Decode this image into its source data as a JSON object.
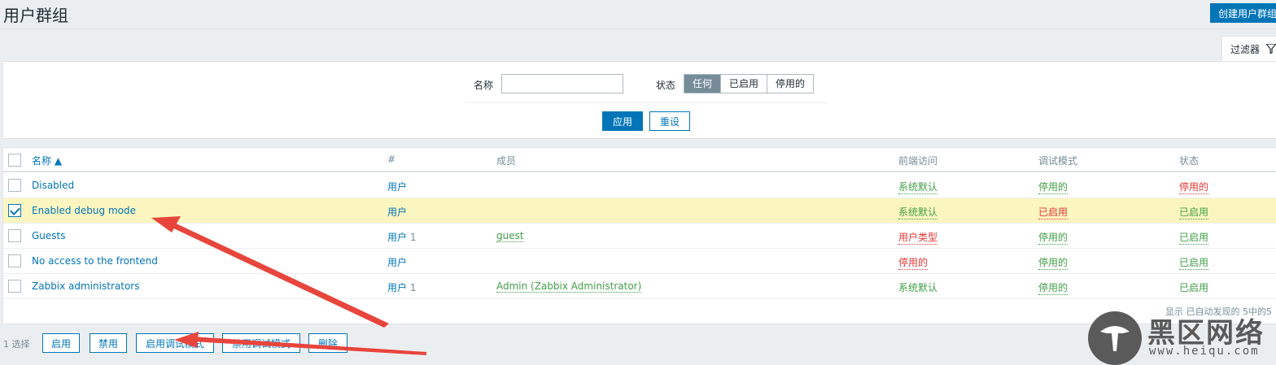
{
  "header": {
    "title": "用户群组",
    "create_label": "创建用户群组"
  },
  "filter": {
    "tab_label": "过滤器",
    "name_label": "名称",
    "name_value": "",
    "status_label": "状态",
    "status_options": [
      "任何",
      "已启用",
      "停用的"
    ],
    "status_selected": "任何",
    "apply_label": "应用",
    "reset_label": "重设"
  },
  "table": {
    "columns": [
      "名称 ▲",
      "#",
      "成员",
      "前端访问",
      "调试模式",
      "状态"
    ],
    "rows": [
      {
        "name": "Disabled",
        "users": "用户",
        "count": "",
        "members": "",
        "frontend": "系统默认",
        "debug": "停用的",
        "status": "停用的",
        "checked": false
      },
      {
        "name": "Enabled debug mode",
        "users": "用户",
        "count": "",
        "members": "",
        "frontend": "系统默认",
        "debug": "已启用",
        "status": "已启用",
        "checked": true
      },
      {
        "name": "Guests",
        "users": "用户",
        "count": "1",
        "members": "guest",
        "frontend": "用户类型",
        "debug": "停用的",
        "status": "已启用",
        "checked": false
      },
      {
        "name": "No access to the frontend",
        "users": "用户",
        "count": "",
        "members": "",
        "frontend": "停用的",
        "debug": "停用的",
        "status": "已启用",
        "checked": false
      },
      {
        "name": "Zabbix administrators",
        "users": "用户",
        "count": "1",
        "members": "Admin (Zabbix Administrator)",
        "frontend": "系统默认",
        "debug": "停用的",
        "status": "已启用",
        "checked": false
      }
    ],
    "footer": "显示 已自动发现的 5中的5"
  },
  "actions": {
    "selected_count": "1 选择",
    "buttons": [
      "启用",
      "禁用",
      "启用调试模式",
      "禁用调试模式",
      "删除"
    ]
  },
  "watermark": {
    "text": "黑区网络",
    "url": "www.heiqu.com"
  },
  "colors": {
    "accent": "#0275b8",
    "green": "#429e47",
    "red": "#e33734",
    "arrow": "#e8453c"
  }
}
